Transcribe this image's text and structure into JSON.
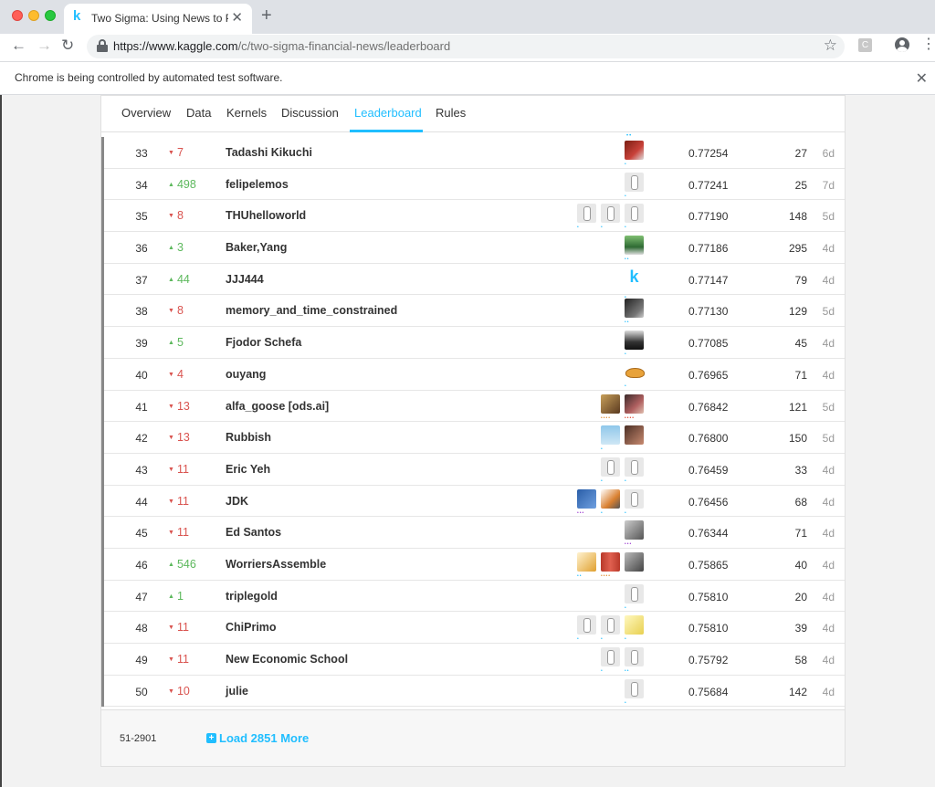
{
  "browser": {
    "tab_title": "Two Sigma: Using News to Pre",
    "tab_favicon": "k",
    "url_host": "https://www.kaggle.com",
    "url_path": "/c/two-sigma-financial-news/leaderboard",
    "ext_label": "C",
    "infobar_text": "Chrome is being controlled by automated test software."
  },
  "subnav": {
    "tabs": [
      "Overview",
      "Data",
      "Kernels",
      "Discussion",
      "Leaderboard",
      "Rules"
    ],
    "active": "Leaderboard"
  },
  "rows": [
    {
      "rank": "33",
      "delta": "7",
      "dir": "down",
      "team": "Tadashi Kikuchi",
      "score": "0.77254",
      "entries": "27",
      "last": "6d",
      "avatars": [
        {
          "style": "av-red",
          "tier": "•",
          "tc": "#20beff"
        }
      ]
    },
    {
      "rank": "34",
      "delta": "498",
      "dir": "up",
      "team": "felipelemos",
      "score": "0.77241",
      "entries": "25",
      "last": "7d",
      "avatars": [
        {
          "style": "av-default",
          "tier": "•",
          "tc": "#20beff"
        }
      ]
    },
    {
      "rank": "35",
      "delta": "8",
      "dir": "down",
      "team": "THUhelloworld",
      "score": "0.77190",
      "entries": "148",
      "last": "5d",
      "avatars": [
        {
          "style": "av-default",
          "tier": "•",
          "tc": "#20beff"
        },
        {
          "style": "av-default",
          "tier": "•",
          "tc": "#20beff"
        },
        {
          "style": "av-default",
          "tier": "•",
          "tc": "#20beff"
        }
      ]
    },
    {
      "rank": "36",
      "delta": "3",
      "dir": "up",
      "team": "Baker,Yang",
      "score": "0.77186",
      "entries": "295",
      "last": "4d",
      "avatars": [
        {
          "style": "av-green",
          "tier": "••",
          "tc": "#20beff"
        }
      ]
    },
    {
      "rank": "37",
      "delta": "44",
      "dir": "up",
      "team": "JJJ444",
      "score": "0.77147",
      "entries": "79",
      "last": "4d",
      "avatars": [
        {
          "style": "av-kaggle",
          "tier": "•",
          "tc": "#20beff"
        }
      ]
    },
    {
      "rank": "38",
      "delta": "8",
      "dir": "down",
      "team": "memory_and_time_constrained",
      "score": "0.77130",
      "entries": "129",
      "last": "5d",
      "avatars": [
        {
          "style": "av-cat",
          "tier": "••",
          "tc": "#20beff"
        }
      ]
    },
    {
      "rank": "39",
      "delta": "5",
      "dir": "up",
      "team": "Fjodor Schefa",
      "score": "0.77085",
      "entries": "45",
      "last": "4d",
      "avatars": [
        {
          "style": "av-dark",
          "tier": "•",
          "tc": "#20beff"
        }
      ]
    },
    {
      "rank": "40",
      "delta": "4",
      "dir": "down",
      "team": "ouyang",
      "score": "0.76965",
      "entries": "71",
      "last": "4d",
      "avatars": [
        {
          "style": "av-hat",
          "tier": "•",
          "tc": "#20beff"
        }
      ]
    },
    {
      "rank": "41",
      "delta": "13",
      "dir": "down",
      "team": "alfa_goose [ods.ai]",
      "score": "0.76842",
      "entries": "121",
      "last": "5d",
      "avatars": [
        {
          "style": "av-photo1",
          "tier": "••••",
          "tc": "#e08a2c"
        },
        {
          "style": "av-photo2",
          "tier": "••••",
          "tc": "#e0442c"
        }
      ]
    },
    {
      "rank": "42",
      "delta": "13",
      "dir": "down",
      "team": "Rubbish",
      "score": "0.76800",
      "entries": "150",
      "last": "5d",
      "avatars": [
        {
          "style": "av-sky",
          "tier": "•",
          "tc": "#20beff"
        },
        {
          "style": "av-brown",
          "tier": "",
          "tc": "#20beff"
        }
      ]
    },
    {
      "rank": "43",
      "delta": "11",
      "dir": "down",
      "team": "Eric Yeh",
      "score": "0.76459",
      "entries": "33",
      "last": "4d",
      "avatars": [
        {
          "style": "av-default",
          "tier": "•",
          "tc": "#20beff"
        },
        {
          "style": "av-default",
          "tier": "•",
          "tc": "#20beff"
        }
      ]
    },
    {
      "rank": "44",
      "delta": "11",
      "dir": "down",
      "team": "JDK",
      "score": "0.76456",
      "entries": "68",
      "last": "4d",
      "avatars": [
        {
          "style": "av-blue",
          "tier": "•••",
          "tc": "#9c3ad0"
        },
        {
          "style": "av-orange",
          "tier": "•",
          "tc": "#20beff"
        },
        {
          "style": "av-default",
          "tier": "•",
          "tc": "#20beff"
        }
      ]
    },
    {
      "rank": "45",
      "delta": "11",
      "dir": "down",
      "team": "Ed Santos",
      "score": "0.76344",
      "entries": "71",
      "last": "4d",
      "avatars": [
        {
          "style": "av-sketch",
          "tier": "•••",
          "tc": "#9c3ad0"
        }
      ]
    },
    {
      "rank": "46",
      "delta": "546",
      "dir": "up",
      "team": "WorriersAssemble",
      "score": "0.75865",
      "entries": "40",
      "last": "4d",
      "avatars": [
        {
          "style": "av-tea",
          "tier": "••",
          "tc": "#20beff"
        },
        {
          "style": "av-people",
          "tier": "••••",
          "tc": "#e08a2c"
        },
        {
          "style": "av-gray",
          "tier": "",
          "tc": "#20beff"
        }
      ]
    },
    {
      "rank": "47",
      "delta": "1",
      "dir": "up",
      "team": "triplegold",
      "score": "0.75810",
      "entries": "20",
      "last": "4d",
      "avatars": [
        {
          "style": "av-default",
          "tier": "•",
          "tc": "#20beff"
        }
      ]
    },
    {
      "rank": "48",
      "delta": "11",
      "dir": "down",
      "team": "ChiPrimo",
      "score": "0.75810",
      "entries": "39",
      "last": "4d",
      "avatars": [
        {
          "style": "av-default",
          "tier": "•",
          "tc": "#20beff"
        },
        {
          "style": "av-default",
          "tier": "•",
          "tc": "#20beff"
        },
        {
          "style": "av-yellow",
          "tier": "•",
          "tc": "#20beff"
        }
      ]
    },
    {
      "rank": "49",
      "delta": "11",
      "dir": "down",
      "team": "New Economic School",
      "score": "0.75792",
      "entries": "58",
      "last": "4d",
      "avatars": [
        {
          "style": "av-default",
          "tier": "•",
          "tc": "#20beff"
        },
        {
          "style": "av-default",
          "tier": "••",
          "tc": "#20beff"
        }
      ]
    },
    {
      "rank": "50",
      "delta": "10",
      "dir": "down",
      "team": "julie",
      "score": "0.75684",
      "entries": "142",
      "last": "4d",
      "avatars": [
        {
          "style": "av-default",
          "tier": "•",
          "tc": "#20beff"
        }
      ]
    }
  ],
  "footer": {
    "range": "51-2901",
    "load_more": "Load 2851 More"
  },
  "colors": {
    "accent": "#20beff",
    "up": "#5cb85c",
    "down": "#d9534f"
  }
}
